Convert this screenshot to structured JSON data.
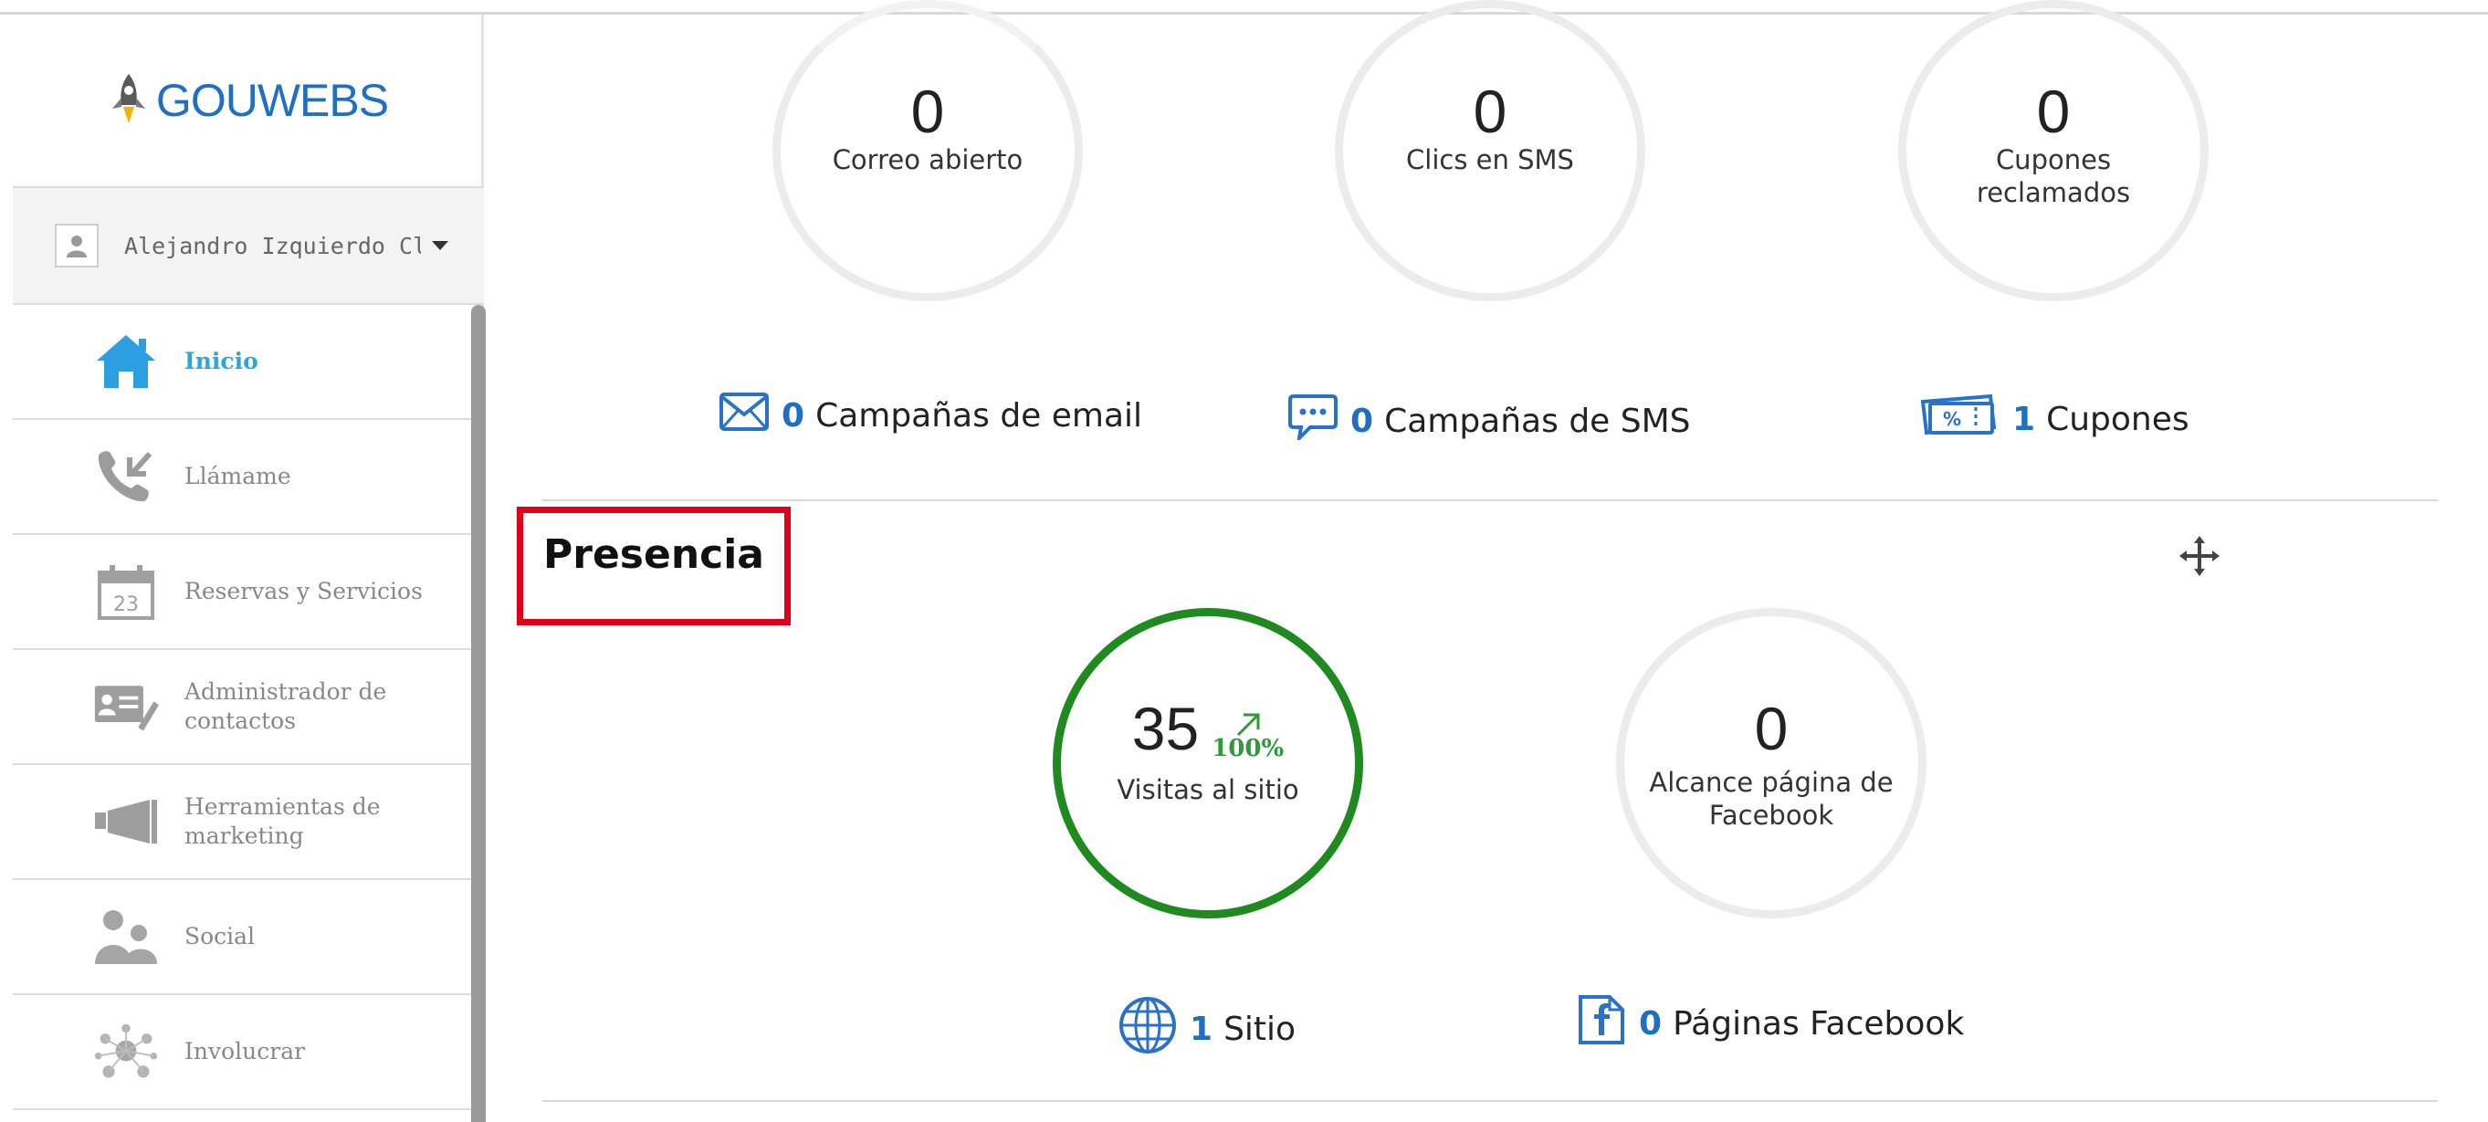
{
  "brand": {
    "logo_text": "GOUWEBS",
    "color": "#1f6fc5"
  },
  "user": {
    "name": "Alejandro Izquierdo Cli"
  },
  "sidebar": {
    "items": [
      {
        "label": "Inicio",
        "icon": "home-icon",
        "active": true
      },
      {
        "label": "Llámame",
        "icon": "phone-icon"
      },
      {
        "label": "Reservas y Servicios",
        "icon": "calendar-icon",
        "calendar_day": "23"
      },
      {
        "label_line1": "Administrador de",
        "label_line2": "contactos",
        "icon": "contact-card-icon"
      },
      {
        "label_line1": "Herramientas de",
        "label_line2": "marketing",
        "icon": "megaphone-icon"
      },
      {
        "label": "Social",
        "icon": "people-icon"
      },
      {
        "label": "Involucrar",
        "icon": "network-icon"
      }
    ]
  },
  "email_section": {
    "circles": [
      {
        "value": "0",
        "label": "Correo abierto"
      },
      {
        "value": "0",
        "label": "Clics en SMS"
      },
      {
        "value": "0",
        "label": "Cupones reclamados"
      }
    ],
    "stats": [
      {
        "count": "0",
        "label": "Campañas de email",
        "icon": "envelope-icon"
      },
      {
        "count": "0",
        "label": "Campañas de SMS",
        "icon": "sms-bubble-icon"
      },
      {
        "count": "1",
        "label": "Cupones",
        "icon": "coupon-icon"
      }
    ]
  },
  "presence_section": {
    "title": "Presencia",
    "circles": [
      {
        "value": "35",
        "growth": "100%",
        "label": "Visitas al sitio",
        "highlight_color": "#1f8a1f"
      },
      {
        "value": "0",
        "label": "Alcance página de Facebook"
      }
    ],
    "stats": [
      {
        "count": "1",
        "label": "Sitio",
        "icon": "globe-icon"
      },
      {
        "count": "0",
        "label": "Páginas Facebook",
        "icon": "facebook-icon"
      }
    ]
  },
  "colors": {
    "accent": "#29a6e0",
    "highlight_box": "#e0001a",
    "count": "#1f6fc5"
  }
}
